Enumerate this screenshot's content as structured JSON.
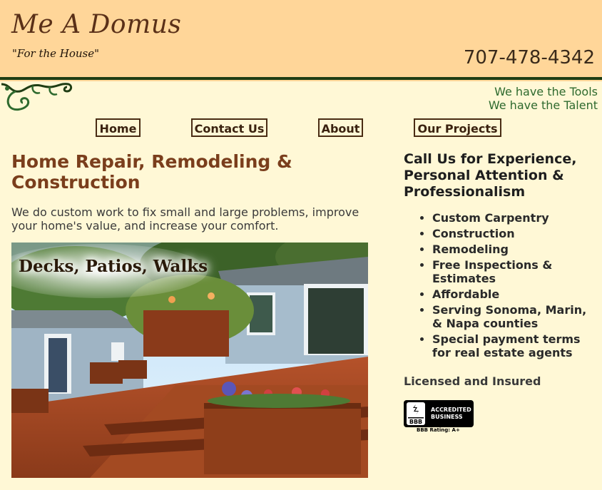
{
  "header": {
    "site_title": "Me A Domus",
    "tagline": "\"For the House\"",
    "phone": "707-478-4342"
  },
  "slogans": [
    "We have the Tools",
    "We have the Talent"
  ],
  "nav": {
    "items": [
      {
        "label": "Home"
      },
      {
        "label": "Contact Us"
      },
      {
        "label": "About"
      },
      {
        "label": "Our Projects"
      }
    ]
  },
  "main": {
    "heading": "Home Repair, Remodeling & Construction",
    "intro": "We do custom work to fix small and large problems, improve your home's value, and increase your comfort.",
    "photo_caption": "Decks, Patios, Walks"
  },
  "sidebar": {
    "heading": "Call Us for Experience, Personal Attention & Professionalism",
    "features": [
      "Custom Carpentry",
      "Construction",
      "Remodeling",
      "Free Inspections & Estimates",
      "Affordable",
      "Serving Sonoma, Marin, & Napa counties",
      "Special payment terms for real estate agents"
    ],
    "licensed": "Licensed and Insured",
    "badge": {
      "line1": "ACCREDITED",
      "line2": "BUSINESS",
      "seal": "BBB",
      "rating": "BBB Rating: A+"
    }
  },
  "colors": {
    "header_bg": "#ffd699",
    "page_bg": "#fff8d6",
    "title": "#5a3018",
    "heading": "#7a3e1c",
    "slogan": "#2e6a2e",
    "rule": "#1f3d14"
  }
}
